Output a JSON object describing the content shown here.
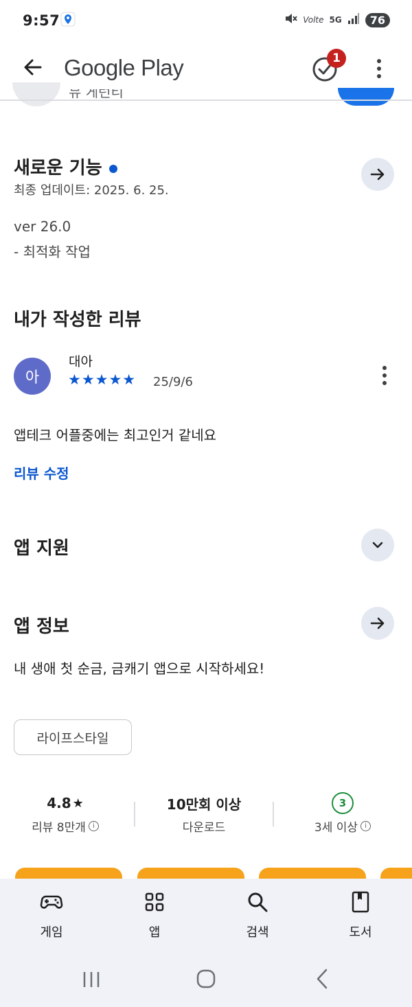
{
  "status_bar": {
    "time": "9:57",
    "network": "5G",
    "volte": "Volte",
    "battery": "76"
  },
  "app_bar": {
    "title": "Google Play",
    "notification_count": "1"
  },
  "partial_row_text": "뮤 게런티",
  "whats_new": {
    "title": "새로운 기능",
    "updated": "최종 업데이트: 2025. 6. 25.",
    "version": "ver 26.0",
    "note": "- 최적화 작업"
  },
  "my_review": {
    "title": "내가 작성한 리뷰",
    "avatar_letter": "아",
    "author": "대아",
    "stars": "★★★★★",
    "date": "25/9/6",
    "text": "앱테크 어플중에는 최고인거 같네요",
    "edit_link": "리뷰 수정"
  },
  "app_support": {
    "title": "앱 지원"
  },
  "app_info": {
    "title": "앱 정보",
    "description": "내 생애 첫 순금, 금캐기 앱으로 시작하세요!",
    "category_chip": "라이프스타일"
  },
  "stats": {
    "rating": "4.8",
    "rating_star": "★",
    "reviews": "리뷰 8만개",
    "downloads": "10만회 이상",
    "downloads_label": "다운로드",
    "age_badge": "3",
    "age_label": "3세 이상"
  },
  "bottom_nav": {
    "items": [
      {
        "label": "게임",
        "icon": "gamepad-icon"
      },
      {
        "label": "앱",
        "icon": "apps-grid-icon"
      },
      {
        "label": "검색",
        "icon": "search-icon"
      },
      {
        "label": "도서",
        "icon": "book-icon"
      }
    ]
  },
  "colors": {
    "accent": "#0b57d0",
    "badge": "#c5221f",
    "avatar": "#5f6bc9",
    "age_green": "#1e8e3e",
    "screenshot_orange": "#f6a21b"
  }
}
